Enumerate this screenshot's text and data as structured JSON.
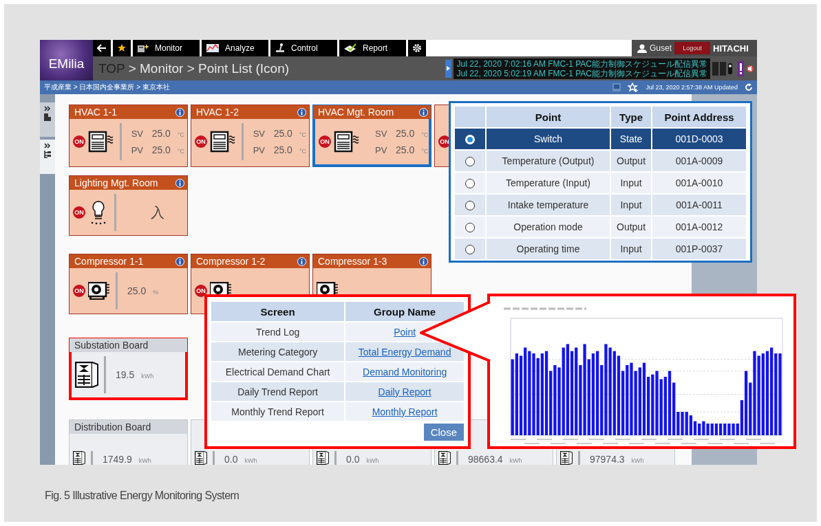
{
  "header": {
    "logo": "EMilia",
    "nav": [
      {
        "kind": "back"
      },
      {
        "kind": "favorite"
      },
      {
        "kind": "monitor",
        "label": "Monitor"
      },
      {
        "kind": "analyze",
        "label": "Analyze"
      },
      {
        "kind": "control",
        "label": "Control"
      },
      {
        "kind": "report",
        "label": "Report"
      },
      {
        "kind": "settings"
      }
    ],
    "user": "Guset",
    "logout": "Logout",
    "brand": "HITACHI"
  },
  "title": {
    "root": "TOP",
    "path": "> Monitor > Point List (Icon)"
  },
  "messages": [
    "Jul 22, 2020 7:02:16 AM FMC-1 PAC能力制御スケジュール配信異常",
    "Jul 22, 2020 5:02:19 AM FMC-1 PAC能力制御スケジュール配信異常"
  ],
  "breadcrumb": "平成産業 > 日本国内全事業所 > 東京本社",
  "updated": "Jul 23, 2020 2:57:38 AM Updated",
  "card_rows": [
    [
      {
        "kind": "hvac",
        "title": "HVAC 1-1",
        "status": "ON",
        "readings": [
          {
            "label": "SV",
            "value": "25.0",
            "unit": "°C"
          },
          {
            "label": "PV",
            "value": "25.0",
            "unit": "°C"
          }
        ]
      },
      {
        "kind": "hvac",
        "title": "HVAC 1-2",
        "status": "ON",
        "readings": [
          {
            "label": "SV",
            "value": "25.0",
            "unit": "°C"
          },
          {
            "label": "PV",
            "value": "25.0",
            "unit": "°C"
          }
        ]
      },
      {
        "kind": "hvac",
        "title": "HVAC Mgt. Room",
        "status": "ON",
        "color": "#1a6fc4",
        "readings": [
          {
            "label": "SV",
            "value": "25.0",
            "unit": "°C"
          },
          {
            "label": "PV",
            "value": "25.0",
            "unit": "°C"
          }
        ]
      },
      {
        "kind": "hvac",
        "status": "ON"
      }
    ],
    [
      {
        "kind": "lighting",
        "title": "Lighting Mgt. Room",
        "status": "ON",
        "readings": [
          {
            "value": "入"
          }
        ]
      }
    ],
    [
      {
        "kind": "compressor",
        "title": "Compressor 1-1",
        "status": "ON",
        "readings": [
          {
            "value": "25.0",
            "unit": "%"
          }
        ]
      },
      {
        "kind": "compressor",
        "title": "Compressor 1-2",
        "status": "ON"
      },
      {
        "kind": "compressor",
        "title": "Compressor 1-3"
      }
    ],
    [
      {
        "kind": "board",
        "title": "Substation Board",
        "color": "#ff0000",
        "readings": [
          {
            "value": "19.5",
            "unit": "kWh"
          }
        ]
      }
    ],
    [
      {
        "kind": "board",
        "title": "Distribution Board",
        "readings": [
          {
            "value": "1749.9",
            "unit": "kWh"
          }
        ]
      },
      {
        "kind": "board",
        "readings": [
          {
            "value": "0.0",
            "unit": "kWh"
          }
        ]
      },
      {
        "kind": "board",
        "readings": [
          {
            "value": "0.0",
            "unit": "kWh"
          }
        ]
      },
      {
        "kind": "board",
        "readings": [
          {
            "value": "98663.4",
            "unit": "kWh"
          }
        ]
      },
      {
        "kind": "board",
        "readings": [
          {
            "value": "97974.3",
            "unit": "kWh"
          }
        ]
      }
    ]
  ],
  "point_table": {
    "columns": [
      "Point",
      "Type",
      "Point Address"
    ],
    "rows": [
      {
        "selected": true,
        "point": "Switch",
        "type": "State",
        "address": "001D-0003"
      },
      {
        "selected": false,
        "point": "Temperature (Output)",
        "type": "Output",
        "address": "001A-0009"
      },
      {
        "selected": false,
        "point": "Temperature (Input)",
        "type": "Input",
        "address": "001A-0010"
      },
      {
        "selected": false,
        "point": "Intake temperature",
        "type": "Input",
        "address": "001A-0011"
      },
      {
        "selected": false,
        "point": "Operation mode",
        "type": "Output",
        "address": "001A-0012"
      },
      {
        "selected": false,
        "point": "Operating time",
        "type": "Input",
        "address": "001P-0037"
      }
    ]
  },
  "screen_table": {
    "columns": [
      "Screen",
      "Group Name"
    ],
    "rows": [
      {
        "screen": "Trend Log",
        "group": "Point"
      },
      {
        "screen": "Metering Category",
        "group": "Total Energy Demand"
      },
      {
        "screen": "Electrical Demand Chart",
        "group": "Demand Monitoring"
      },
      {
        "screen": "Daily Trend Report",
        "group": "Daily Report"
      },
      {
        "screen": "Monthly Trend Report",
        "group": "Monthly Report"
      }
    ],
    "close": "Close"
  },
  "caption": "Fig. 5 Illustrative Energy Monitoring System"
}
